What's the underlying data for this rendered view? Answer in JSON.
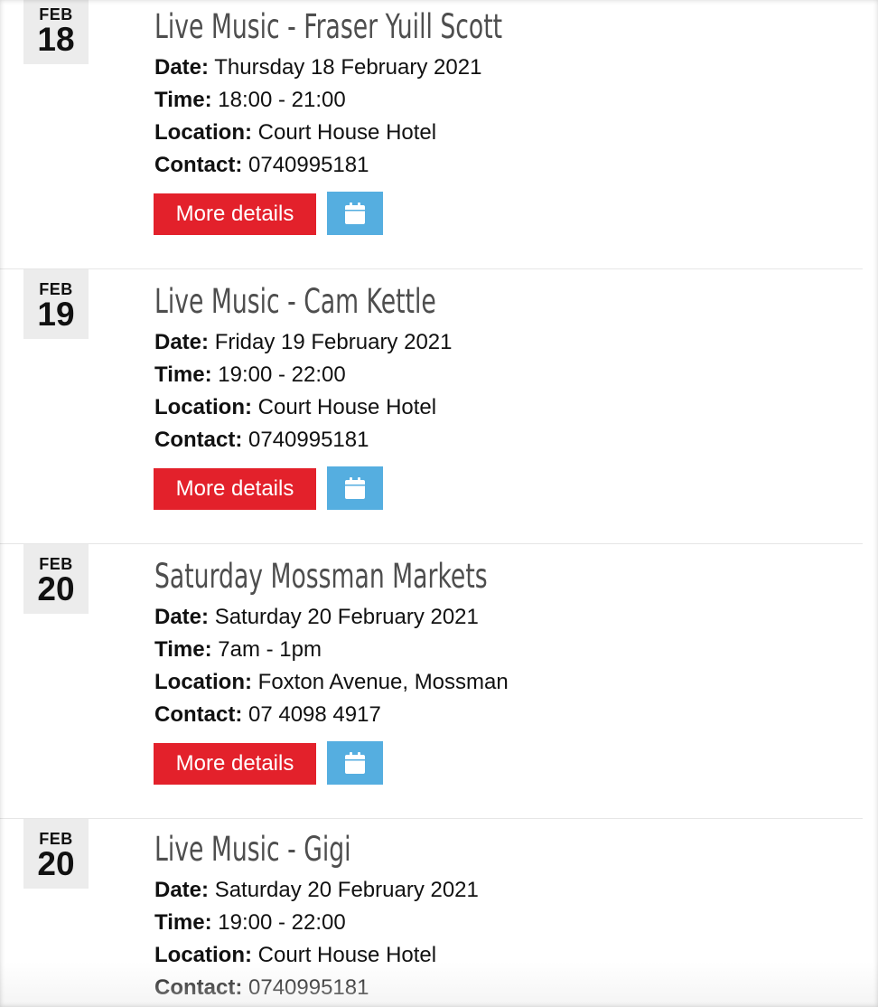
{
  "events": [
    {
      "month": "FEB",
      "day": "18",
      "title": "Live Music - Fraser Yuill Scott",
      "date_label": "Date:",
      "date": "Thursday 18 February 2021",
      "time_label": "Time:",
      "time": "18:00 - 21:00",
      "location_label": "Location:",
      "location": "Court House Hotel",
      "contact_label": "Contact:",
      "contact": "0740995181",
      "more_label": "More details",
      "calendar_icon": "calendar-icon"
    },
    {
      "month": "FEB",
      "day": "19",
      "title": "Live Music - Cam Kettle",
      "date_label": "Date:",
      "date": "Friday 19 February 2021",
      "time_label": "Time:",
      "time": "19:00 - 22:00",
      "location_label": "Location:",
      "location": "Court House Hotel",
      "contact_label": "Contact:",
      "contact": "0740995181",
      "more_label": "More details",
      "calendar_icon": "calendar-icon"
    },
    {
      "month": "FEB",
      "day": "20",
      "title": "Saturday Mossman Markets",
      "date_label": "Date:",
      "date": "Saturday 20 February 2021",
      "time_label": "Time:",
      "time": "7am - 1pm",
      "location_label": "Location:",
      "location": "Foxton Avenue, Mossman",
      "contact_label": "Contact:",
      "contact": "07 4098 4917",
      "more_label": "More details",
      "calendar_icon": "calendar-icon"
    },
    {
      "month": "FEB",
      "day": "20",
      "title": "Live Music - Gigi",
      "date_label": "Date:",
      "date": "Saturday 20 February 2021",
      "time_label": "Time:",
      "time": "19:00 - 22:00",
      "location_label": "Location:",
      "location": "Court House Hotel",
      "contact_label": "Contact:",
      "contact": "0740995181"
    }
  ],
  "colors": {
    "more_button": "#e3212b",
    "calendar_button": "#55aee0",
    "badge_bg": "#ececec",
    "title": "#4e4e4e"
  }
}
